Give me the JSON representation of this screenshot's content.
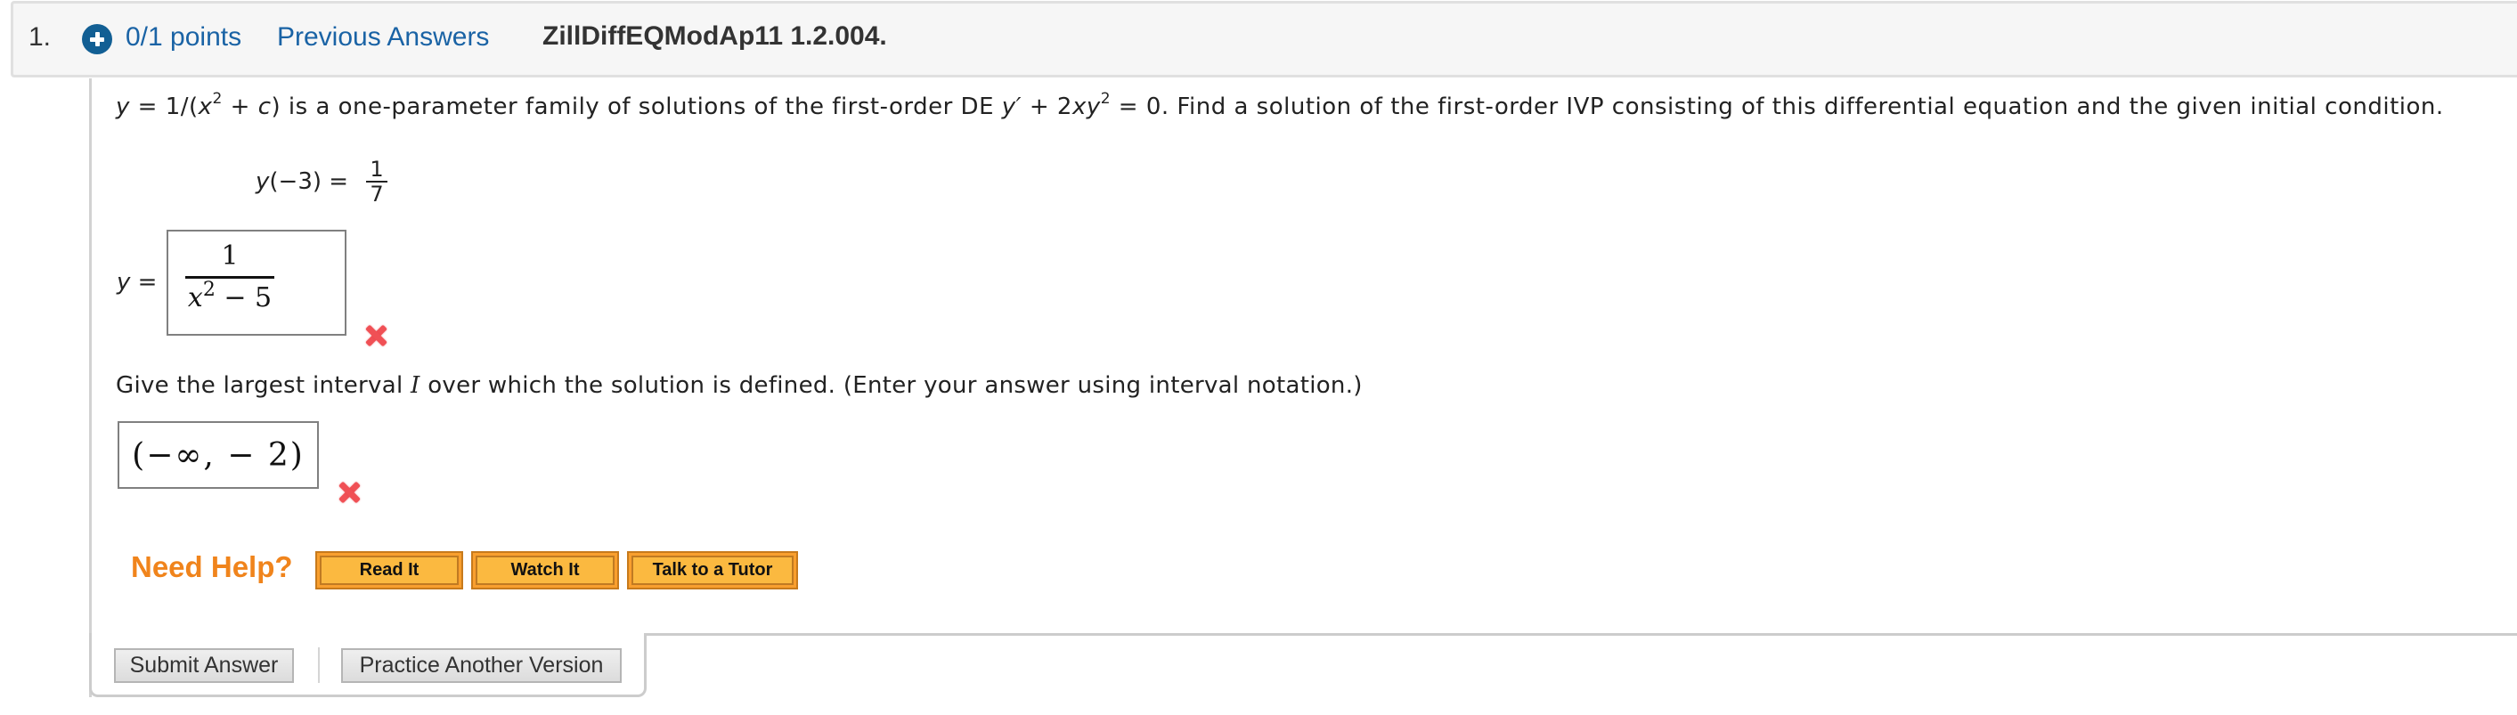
{
  "header": {
    "question_number": "1.",
    "expand_icon": "plus-circle-icon",
    "points": "0/1 points",
    "previous_answers": "Previous Answers",
    "question_id": "ZillDiffEQModAp11 1.2.004."
  },
  "question": {
    "part1_y": "y",
    "part2": " = 1/(",
    "part3_x": "x",
    "part4_sup": "2",
    "part5": " + ",
    "part6_c": "c",
    "part7": ") is a one-parameter family of solutions of the first-order DE ",
    "part8_yprime": "y′",
    "part9": " + 2",
    "part10_xy": "xy",
    "part11_sup": "2",
    "part12": " = 0. Find a solution of the first-order IVP consisting of this differential equation and the given initial condition."
  },
  "initial_condition": {
    "lhs_y": "y",
    "lhs_rest": "(−3) = ",
    "numerator": "1",
    "denominator": "7"
  },
  "answer1": {
    "label_y": "y",
    "label_eq": " =",
    "numerator": "1",
    "denominator_x": "x",
    "denominator_sup": "2",
    "denominator_rest": " − 5",
    "status": "incorrect",
    "status_icon": "x-mark-icon"
  },
  "interval_prompt": {
    "part1": "Give the largest interval ",
    "part2_I": "I",
    "part3": " over which the solution is defined. (Enter your answer using interval notation.)"
  },
  "answer2": {
    "value": "(−∞, − 2)",
    "status": "incorrect",
    "status_icon": "x-mark-icon"
  },
  "help": {
    "label": "Need Help?",
    "buttons": [
      "Read It",
      "Watch It",
      "Talk to a Tutor"
    ]
  },
  "actions": {
    "submit": "Submit Answer",
    "practice": "Practice Another Version"
  },
  "colors": {
    "link_blue": "#1a63a5",
    "icon_blue": "#125f94",
    "help_orange": "#f0841c",
    "help_button": "#fbb940",
    "incorrect_red": "#f05055"
  }
}
